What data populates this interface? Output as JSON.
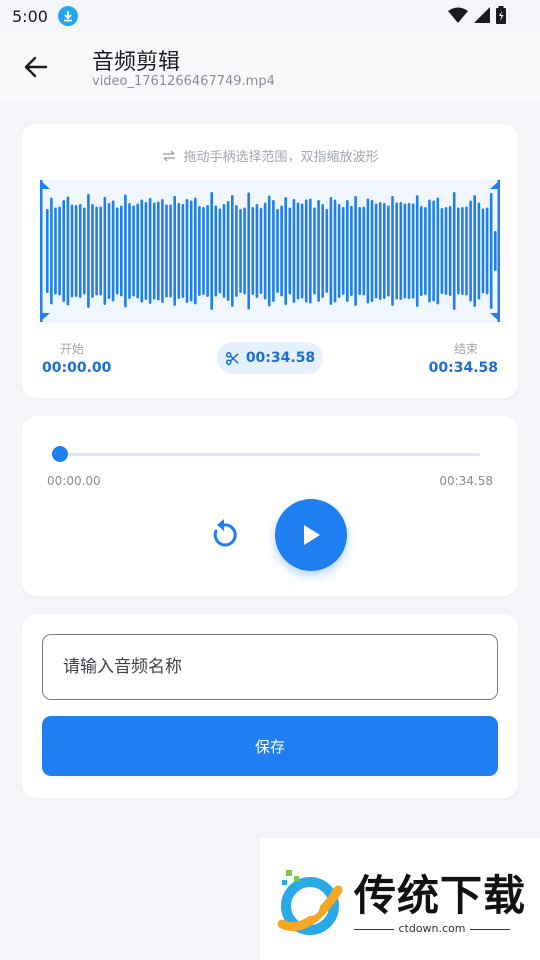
{
  "status": {
    "time": "5:00"
  },
  "header": {
    "title": "音频剪辑",
    "subtitle": "video_1761266467749.mp4"
  },
  "waveform_card": {
    "hint": "拖动手柄选择范围，双指缩放波形",
    "start_label": "开始",
    "start_time": "00:00.00",
    "duration": "00:34.58",
    "end_label": "结束",
    "end_time": "00:34.58",
    "selection_start_fraction": 0,
    "selection_end_fraction": 1
  },
  "player": {
    "position": "00:00.00",
    "total": "00:34.58",
    "progress": 0
  },
  "save_form": {
    "name_placeholder": "请输入音频名称",
    "name_value": "",
    "save_label": "保存"
  },
  "watermark": {
    "brand": "传统下载",
    "url": "ctdown.com"
  },
  "colors": {
    "accent": "#1f7ef0",
    "accent_dark": "#1c6ed4",
    "wave_bg": "#eff6fd"
  }
}
